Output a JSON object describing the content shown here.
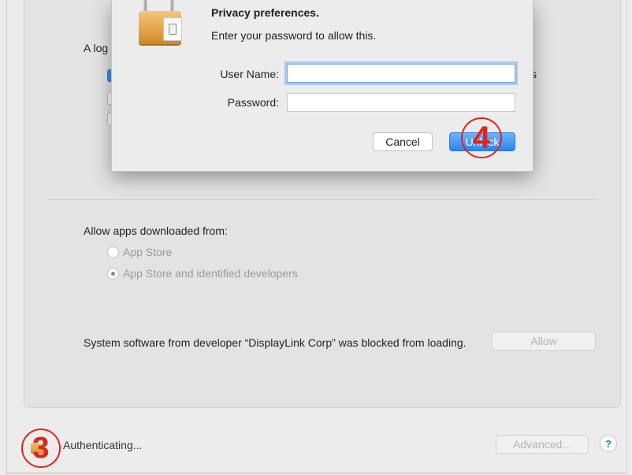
{
  "background": {
    "partial_label": "A log",
    "partial_suffix": "s"
  },
  "downloads": {
    "label": "Allow apps downloaded from:",
    "options": [
      {
        "label": "App Store",
        "selected": false
      },
      {
        "label": "App Store and identified developers",
        "selected": true
      }
    ]
  },
  "blocked": {
    "message": "System software from developer “DisplayLink Corp” was blocked from loading.",
    "allow_label": "Allow"
  },
  "footer": {
    "status_text": "Authenticating...",
    "advanced_label": "Advanced...",
    "help_label": "?",
    "lock_icon": "lock-icon"
  },
  "dialog": {
    "title": "Privacy preferences.",
    "subtitle": "Enter your password to allow this.",
    "username_label": "User Name:",
    "username_value": "",
    "password_label": "Password:",
    "password_value": "",
    "cancel_label": "Cancel",
    "unlock_label": "Unlock"
  },
  "annotations": {
    "step_3": "3",
    "step_4": "4"
  },
  "colors": {
    "accent": "#2a84f0",
    "callout": "#e2231a",
    "lock": "#e0a145"
  }
}
